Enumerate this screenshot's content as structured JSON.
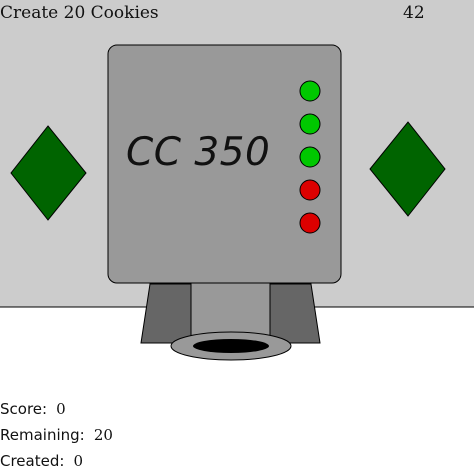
{
  "task": "Create 20 Cookies",
  "timer": "42",
  "machine": {
    "label": "CC 350",
    "lights": [
      "green",
      "green",
      "green",
      "red",
      "red"
    ]
  },
  "buttons": [
    {
      "name": "left-diamond-button",
      "icon": "diamond-icon"
    },
    {
      "name": "right-diamond-button",
      "icon": "diamond-icon"
    }
  ],
  "stats": {
    "score_label": "Score:",
    "score": "0",
    "remaining_label": "Remaining:",
    "remaining": "20",
    "created_label": "Created:",
    "created": "0"
  },
  "colors": {
    "background_panel": "#cccccc",
    "machine_body": "#999999",
    "nozzle_dark": "#666666",
    "diamond": "#006400",
    "light_green": "#00c800",
    "light_red": "#dc0000",
    "hole": "#000000"
  }
}
